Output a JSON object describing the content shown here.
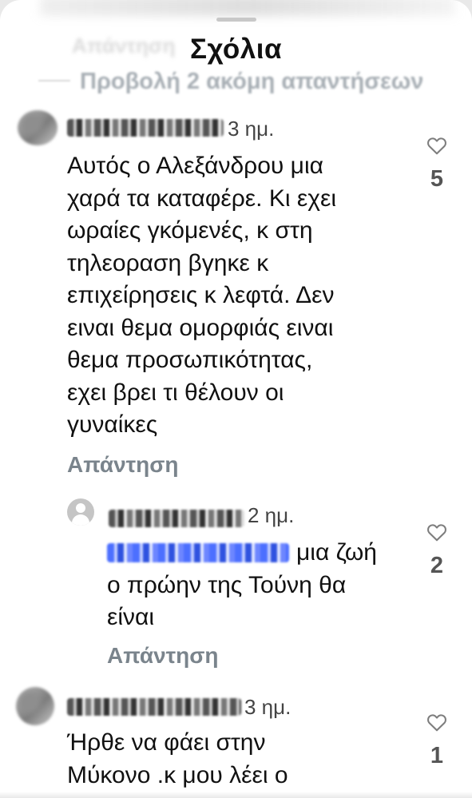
{
  "sheet": {
    "title": "Σχόλια",
    "ghost_reply_label": "Απάντηση",
    "view_more_replies": "Προβολή 2 ακόμη απαντήσεων"
  },
  "comments": [
    {
      "time": "3 ημ.",
      "text_lines": [
        "Αυτός ο Αλεξάνδρου μια",
        "χαρά τα καταφέρε. Κι εχει",
        "ωραίες γκόμενές, κ στη",
        "τηλεοραση βγηκε κ",
        "επιχείρησεις κ λεφτά. Δεν",
        "ειναι θεμα ομορφιάς ειναι",
        "θεμα προσωπικότητας,",
        "εχει βρει τι θέλουν οι",
        "γυναίκες"
      ],
      "reply_label": "Απάντηση",
      "likes": "5"
    },
    {
      "time": "2 ημ.",
      "text_lines": [
        "μια ζωή",
        "ο πρώην της Τούνη θα",
        "είναι"
      ],
      "reply_label": "Απάντηση",
      "likes": "2"
    },
    {
      "time": "3 ημ.",
      "text_lines": [
        "Ήρθε να φάει στην",
        "Μύκονο .κ μου λέει ο"
      ],
      "likes": "1"
    }
  ],
  "icons": {
    "like": "heart-outline-icon",
    "default_avatar": "person-icon"
  },
  "colors": {
    "background": "#ffffff",
    "text": "#111111",
    "secondary": "#7a848c",
    "mention": "#3a5cf0"
  }
}
